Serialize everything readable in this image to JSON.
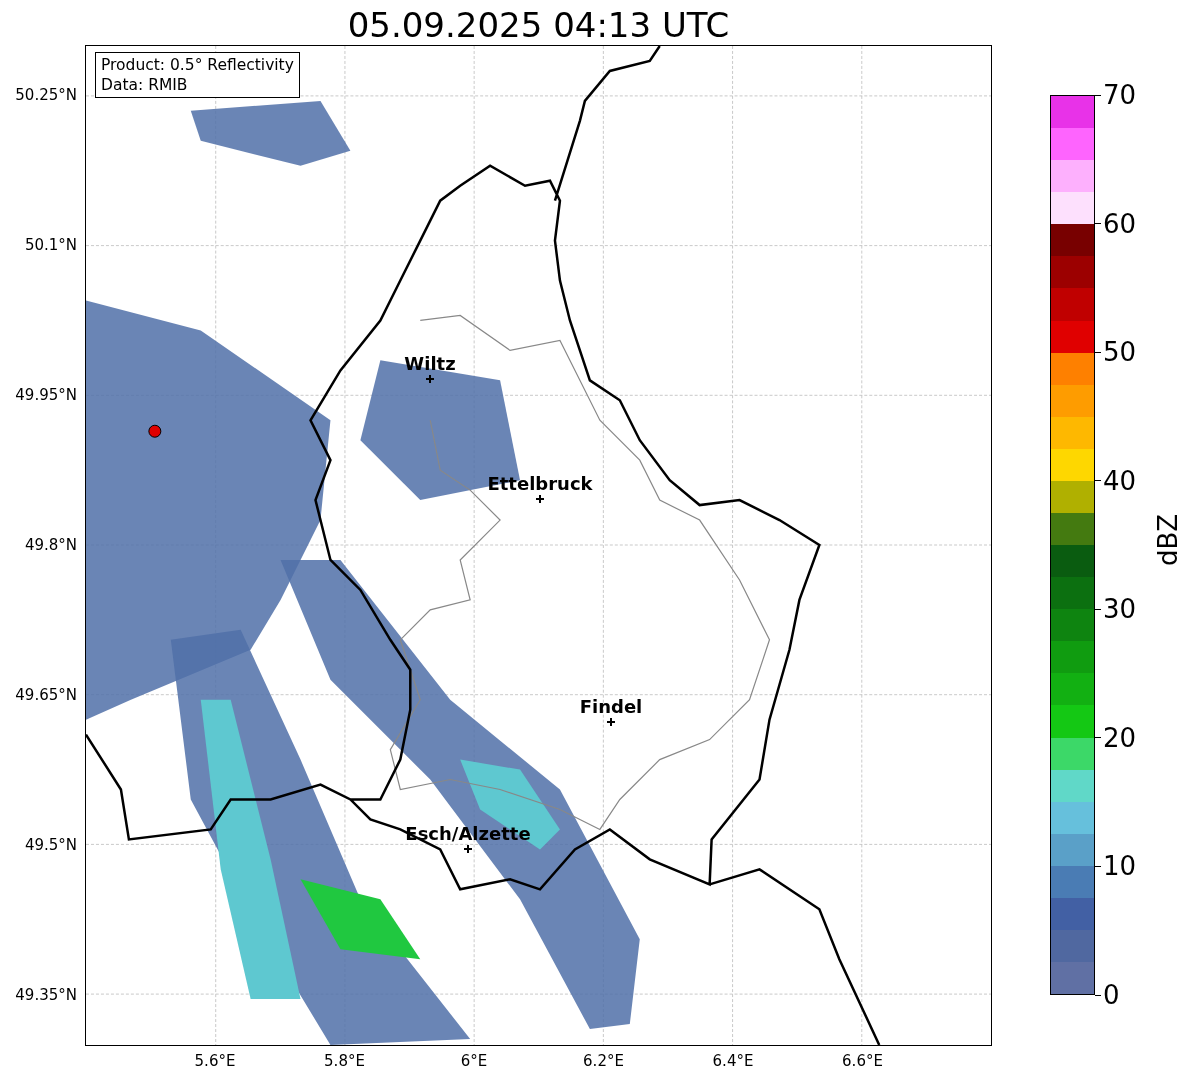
{
  "title": "05.09.2025 04:13 UTC",
  "map": {
    "info_box": [
      "Product: 0.5° Reflectivity",
      "Data: RMIB"
    ],
    "y_ticks": [
      "50.25°N",
      "50.1°N",
      "49.95°N",
      "49.8°N",
      "49.65°N",
      "49.5°N",
      "49.35°N"
    ],
    "x_ticks": [
      "5.6°E",
      "5.8°E",
      "6°E",
      "6.2°E",
      "6.4°E",
      "6.6°E"
    ],
    "places": [
      {
        "name": "Wiltz"
      },
      {
        "name": "Ettelbruck"
      },
      {
        "name": "Findel"
      },
      {
        "name": "Esch/Alzette"
      }
    ]
  },
  "colorbar": {
    "label": "dBZ",
    "ticks": [
      "70",
      "60",
      "50",
      "40",
      "30",
      "20",
      "10",
      "0"
    ],
    "bands": [
      {
        "color": "#e832e8"
      },
      {
        "color": "#fe64fe"
      },
      {
        "color": "#fdb0fd"
      },
      {
        "color": "#fde0fd"
      },
      {
        "color": "#780000"
      },
      {
        "color": "#9c0000"
      },
      {
        "color": "#c00000"
      },
      {
        "color": "#e00000"
      },
      {
        "color": "#fe8000"
      },
      {
        "color": "#fe9c00"
      },
      {
        "color": "#feb800"
      },
      {
        "color": "#fed700"
      },
      {
        "color": "#b0b000"
      },
      {
        "color": "#447a10"
      },
      {
        "color": "#0a5c10"
      },
      {
        "color": "#0c7010"
      },
      {
        "color": "#0e8410"
      },
      {
        "color": "#109c10"
      },
      {
        "color": "#12b012"
      },
      {
        "color": "#14c814"
      },
      {
        "color": "#3cd868"
      },
      {
        "color": "#60d8c8"
      },
      {
        "color": "#66c0dc"
      },
      {
        "color": "#5aa0c8"
      },
      {
        "color": "#4a7cb4"
      },
      {
        "color": "#4260a4"
      },
      {
        "color": "#5068a0"
      },
      {
        "color": "#6070a4"
      }
    ]
  }
}
